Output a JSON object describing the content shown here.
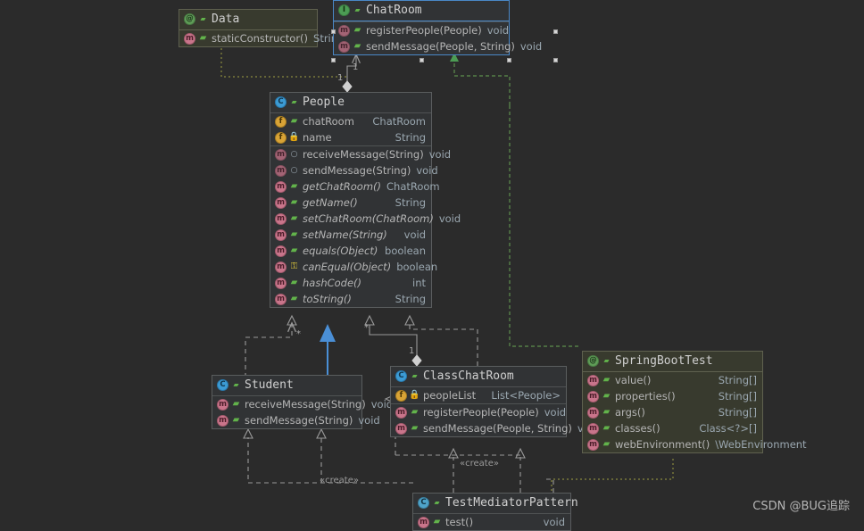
{
  "canvas": {
    "background": "#2b2b2b",
    "watermark": "CSDN @BUG追踪"
  },
  "nodes": {
    "data": {
      "title": "Data",
      "kind": "annotation",
      "icon": "annotation-icon",
      "members": [
        {
          "icon": "method-icon",
          "visibility": "package",
          "name": "staticConstructor()",
          "type": "String",
          "italic": false
        }
      ]
    },
    "chatroom": {
      "title": "ChatRoom",
      "kind": "interface",
      "icon": "interface-icon",
      "selected": true,
      "members": [
        {
          "icon": "method-abstract-icon",
          "visibility": "public",
          "name": "registerPeople(People)",
          "type": "void",
          "italic": false
        },
        {
          "icon": "method-abstract-icon",
          "visibility": "public",
          "name": "sendMessage(People, String)",
          "type": "void",
          "italic": false
        }
      ]
    },
    "people": {
      "title": "People",
      "kind": "class",
      "icon": "class-icon",
      "fields": [
        {
          "icon": "field-icon",
          "visibility": "public",
          "name": "chatRoom",
          "type": "ChatRoom",
          "italic": false
        },
        {
          "icon": "field-icon",
          "visibility": "private",
          "name": "name",
          "type": "String",
          "italic": false
        }
      ],
      "methods": [
        {
          "icon": "method-abstract-icon",
          "visibility": "abstract",
          "name": "receiveMessage(String)",
          "type": "void",
          "italic": false
        },
        {
          "icon": "method-abstract-icon",
          "visibility": "abstract",
          "name": "sendMessage(String)",
          "type": "void",
          "italic": false
        },
        {
          "icon": "method-icon",
          "visibility": "public",
          "name": "getChatRoom()",
          "type": "ChatRoom",
          "italic": true
        },
        {
          "icon": "method-icon",
          "visibility": "public",
          "name": "getName()",
          "type": "String",
          "italic": true
        },
        {
          "icon": "method-icon",
          "visibility": "public",
          "name": "setChatRoom(ChatRoom)",
          "type": "void",
          "italic": true
        },
        {
          "icon": "method-icon",
          "visibility": "public",
          "name": "setName(String)",
          "type": "void",
          "italic": true
        },
        {
          "icon": "method-icon",
          "visibility": "public",
          "name": "equals(Object)",
          "type": "boolean",
          "italic": true
        },
        {
          "icon": "method-icon",
          "visibility": "protected",
          "name": "canEqual(Object)",
          "type": "boolean",
          "italic": true
        },
        {
          "icon": "method-icon",
          "visibility": "public",
          "name": "hashCode()",
          "type": "int",
          "italic": true
        },
        {
          "icon": "method-icon",
          "visibility": "public",
          "name": "toString()",
          "type": "String",
          "italic": true
        }
      ]
    },
    "student": {
      "title": "Student",
      "kind": "class",
      "icon": "class-icon",
      "members": [
        {
          "icon": "method-icon",
          "visibility": "public",
          "name": "receiveMessage(String)",
          "type": "void",
          "italic": false
        },
        {
          "icon": "method-icon",
          "visibility": "public",
          "name": "sendMessage(String)",
          "type": "void",
          "italic": false
        }
      ]
    },
    "classchatroom": {
      "title": "ClassChatRoom",
      "kind": "class",
      "icon": "class-icon",
      "fields": [
        {
          "icon": "field-icon",
          "visibility": "private",
          "name": "peopleList",
          "type": "List<People>",
          "italic": false
        }
      ],
      "methods": [
        {
          "icon": "method-icon",
          "visibility": "public",
          "name": "registerPeople(People)",
          "type": "void",
          "italic": false
        },
        {
          "icon": "method-icon",
          "visibility": "public",
          "name": "sendMessage(People, String)",
          "type": "void",
          "italic": false
        }
      ]
    },
    "springboottest": {
      "title": "SpringBootTest",
      "kind": "annotation",
      "icon": "annotation-icon",
      "members": [
        {
          "icon": "method-icon",
          "visibility": "public",
          "name": "value()",
          "type": "String[]",
          "italic": false
        },
        {
          "icon": "method-icon",
          "visibility": "public",
          "name": "properties()",
          "type": "String[]",
          "italic": false
        },
        {
          "icon": "method-icon",
          "visibility": "public",
          "name": "args()",
          "type": "String[]",
          "italic": false
        },
        {
          "icon": "method-icon",
          "visibility": "public",
          "name": "classes()",
          "type": "Class<?>[]",
          "italic": false
        },
        {
          "icon": "method-icon",
          "visibility": "public",
          "name": "webEnvironment()",
          "type": "\\WebEnvironment",
          "italic": false
        }
      ]
    },
    "testmediatorpattern": {
      "title": "TestMediatorPattern",
      "kind": "test-class",
      "icon": "test-class-icon",
      "members": [
        {
          "icon": "method-icon",
          "visibility": "public",
          "name": "test()",
          "type": "void",
          "italic": false
        }
      ]
    }
  },
  "edge_labels": [
    {
      "id": "mult-chatroom-1",
      "text": "1"
    },
    {
      "id": "mult-people-1",
      "text": "1"
    },
    {
      "id": "mult-people-star",
      "text": "*"
    },
    {
      "id": "mult-classchatroom-1",
      "text": "1"
    },
    {
      "id": "mult-student-star",
      "text": "*"
    },
    {
      "id": "create-left",
      "text": "«create»"
    },
    {
      "id": "create-right",
      "text": "«create»"
    }
  ],
  "colors": {
    "background": "#2b2b2b",
    "node_fill": "#313335",
    "annotation_fill": "#383a2e",
    "node_border": "#5a5d5e",
    "selection": "#4a88c7",
    "inheritance_solid": "#4a8fd6",
    "inheritance_dashed": "#9a9a9a",
    "annotation_link": "#8a8a3f",
    "green_link": "#5e8f4e",
    "text": "#bbbbbb",
    "type_text": "#9aa7b0"
  }
}
